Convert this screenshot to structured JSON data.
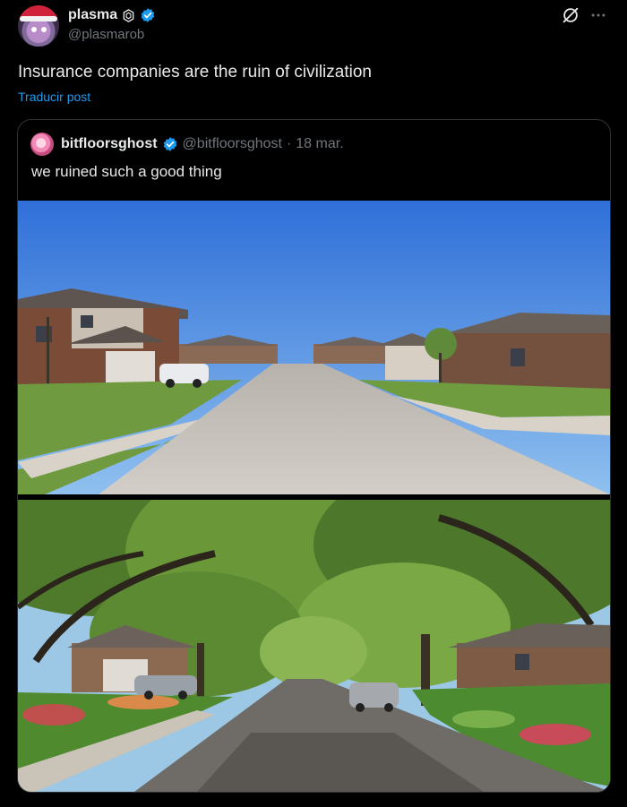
{
  "author": {
    "display_name": "plasma",
    "handle": "@plasmarob",
    "verified": true
  },
  "header_icons": [
    "grok-icon",
    "more-icon"
  ],
  "tweet": {
    "text": "Insurance companies are the ruin of civilization",
    "translate_label": "Traducir post"
  },
  "quoted": {
    "display_name": "bitfloorsghost",
    "handle": "@bitfloorsghost",
    "separator": "·",
    "date": "18 mar.",
    "text": "we ruined such a good thing"
  },
  "colors": {
    "background": "#000000",
    "text": "#e7e9ea",
    "muted": "#71767b",
    "link": "#1d9bf0",
    "verified": "#1d9bf0",
    "border": "#2f3336"
  }
}
